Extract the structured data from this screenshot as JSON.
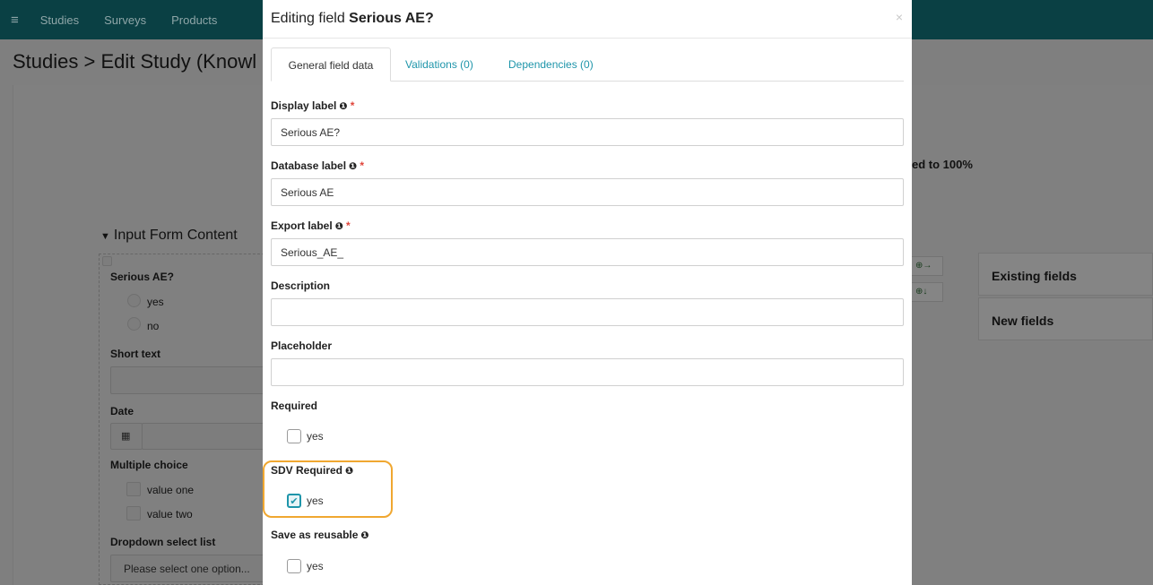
{
  "topbar": {
    "menu_icon": "≡",
    "nav": [
      "Studies",
      "Surveys",
      "Products"
    ]
  },
  "page": {
    "title": "Studies > Edit Study (Knowl",
    "partial_text": "ed to 100%"
  },
  "form_content": {
    "header": "Input Form Content",
    "fields": {
      "serious_ae": "Serious AE?",
      "yes": "yes",
      "no": "no",
      "short_text": "Short text",
      "date": "Date",
      "multiple_choice": "Multiple choice",
      "value_one": "value one",
      "value_two": "value two",
      "dropdown": "Dropdown select list",
      "dropdown_placeholder": "Please select one option..."
    }
  },
  "side_panel": {
    "existing": "Existing fields",
    "new": "New fields",
    "arrow1": "⊕→",
    "arrow2": "⊕↓"
  },
  "modal": {
    "title_prefix": "Editing field ",
    "title_field": "Serious AE?",
    "close": "×",
    "tabs": [
      "General field data",
      "Validations (0)",
      "Dependencies (0)"
    ],
    "display_label": {
      "label": "Display label",
      "value": "Serious AE?"
    },
    "database_label": {
      "label": "Database label",
      "value": "Serious AE"
    },
    "export_label": {
      "label": "Export label",
      "value": "Serious_AE_"
    },
    "description": {
      "label": "Description",
      "value": ""
    },
    "placeholder": {
      "label": "Placeholder",
      "value": ""
    },
    "required": {
      "label": "Required",
      "option": "yes",
      "checked": false
    },
    "sdv_required": {
      "label": "SDV Required",
      "option": "yes",
      "checked": true
    },
    "save_reusable": {
      "label": "Save as reusable",
      "option": "yes",
      "checked": false
    },
    "info_glyph": "❶",
    "req_glyph": "*",
    "check_glyph": "✔"
  },
  "colors": {
    "accent": "#1e95aa",
    "highlight": "#f0a730",
    "topbar": "#0a4044",
    "required": "#e0453b"
  }
}
